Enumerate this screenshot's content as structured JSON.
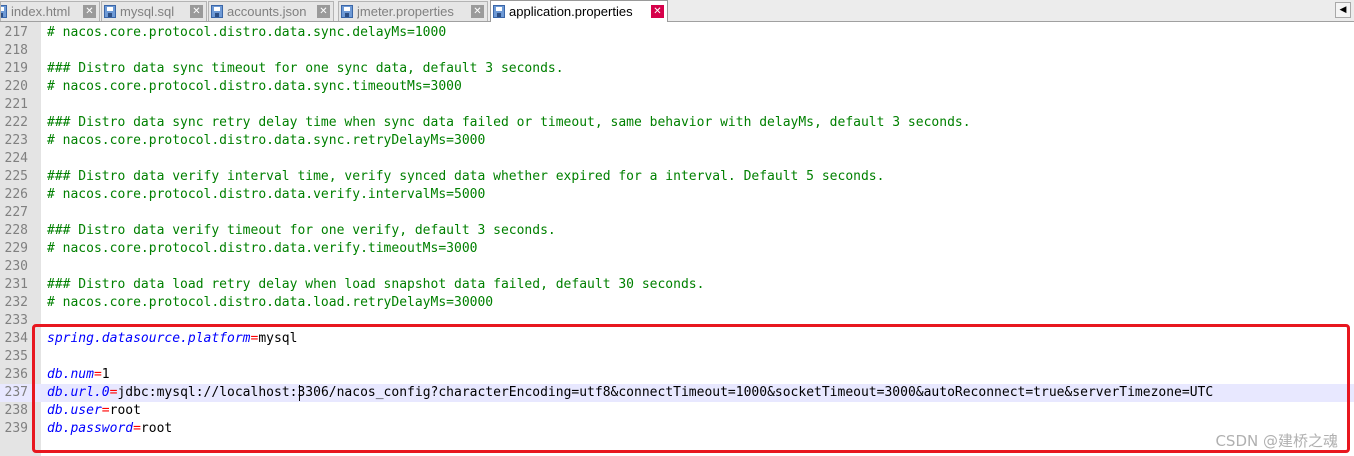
{
  "tabs": [
    {
      "label": "index.html",
      "close": "✕",
      "active": false
    },
    {
      "label": "mysql.sql",
      "close": "✕",
      "active": false
    },
    {
      "label": "accounts.json",
      "close": "✕",
      "active": false
    },
    {
      "label": "jmeter.properties",
      "close": "✕",
      "active": false
    },
    {
      "label": "application.properties",
      "close": "✕",
      "active": true
    }
  ],
  "tab_scroll_left": "◀",
  "editor": {
    "lines": [
      {
        "num": "217",
        "text": "# nacos.core.protocol.distro.data.sync.delayMs=1000"
      },
      {
        "num": "218",
        "text": ""
      },
      {
        "num": "219",
        "text": "### Distro data sync timeout for one sync data, default 3 seconds."
      },
      {
        "num": "220",
        "text": "# nacos.core.protocol.distro.data.sync.timeoutMs=3000"
      },
      {
        "num": "221",
        "text": ""
      },
      {
        "num": "222",
        "text": "### Distro data sync retry delay time when sync data failed or timeout, same behavior with delayMs, default 3 seconds."
      },
      {
        "num": "223",
        "text": "# nacos.core.protocol.distro.data.sync.retryDelayMs=3000"
      },
      {
        "num": "224",
        "text": ""
      },
      {
        "num": "225",
        "text": "### Distro data verify interval time, verify synced data whether expired for a interval. Default 5 seconds."
      },
      {
        "num": "226",
        "text": "# nacos.core.protocol.distro.data.verify.intervalMs=5000"
      },
      {
        "num": "227",
        "text": ""
      },
      {
        "num": "228",
        "text": "### Distro data verify timeout for one verify, default 3 seconds."
      },
      {
        "num": "229",
        "text": "# nacos.core.protocol.distro.data.verify.timeoutMs=3000"
      },
      {
        "num": "230",
        "text": ""
      },
      {
        "num": "231",
        "text": "### Distro data load retry delay when load snapshot data failed, default 30 seconds."
      },
      {
        "num": "232",
        "text": "# nacos.core.protocol.distro.data.load.retryDelayMs=30000"
      },
      {
        "num": "233",
        "text": ""
      },
      {
        "num": "234",
        "key": "spring.datasource.platform",
        "eq": "=",
        "value": "mysql"
      },
      {
        "num": "235",
        "text": ""
      },
      {
        "num": "236",
        "key": "db.num",
        "eq": "=",
        "value": "1"
      },
      {
        "num": "237",
        "key": "db.url.0",
        "eq": "=",
        "value": "jdbc:mysql://localhost:3306/nacos_config?characterEncoding=utf8&connectTimeout=1000&socketTimeout=3000&autoReconnect=true&serverTimezone=UTC",
        "current": true
      },
      {
        "num": "238",
        "key": "db.user",
        "eq": "=",
        "value": "root"
      },
      {
        "num": "239",
        "key": "db.password",
        "eq": "=",
        "value": "root"
      }
    ]
  },
  "watermark": "CSDN @建桥之魂",
  "colors": {
    "comment": "#008000",
    "key": "#0000ff",
    "operator": "#ff0000",
    "highlight_box": "#e8171f",
    "current_line": "#e8e8ff",
    "active_close": "#d6004a"
  }
}
